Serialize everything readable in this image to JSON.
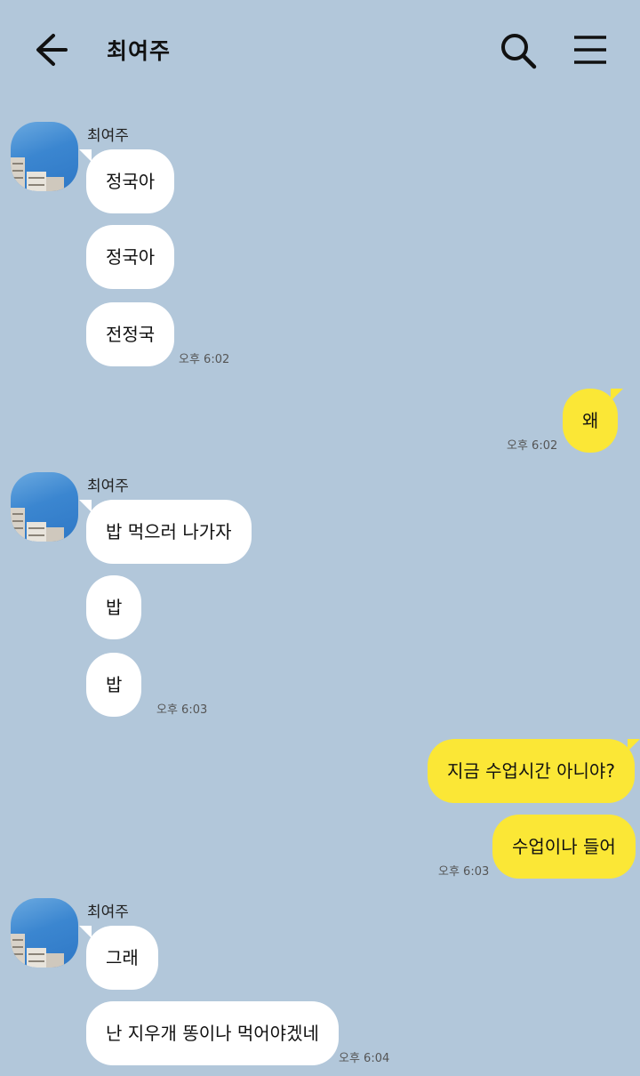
{
  "header": {
    "title": "최여주",
    "back_icon": "arrow-left-icon",
    "search_icon": "search-icon",
    "menu_icon": "hamburger-menu-icon"
  },
  "colors": {
    "background": "#b2c7da",
    "incoming_bubble": "#ffffff",
    "outgoing_bubble": "#fbe736"
  },
  "messages": {
    "group1": {
      "sender": "최여주",
      "m1": "정국아",
      "m2": "정국아",
      "m3": "전정국",
      "time": "오후 6:02"
    },
    "out1": {
      "m1": "왜",
      "time": "오후 6:02"
    },
    "group2": {
      "sender": "최여주",
      "m1": "밥 먹으러 나가자",
      "m2": "밥",
      "m3": "밥",
      "time": "오후 6:03"
    },
    "out2": {
      "m1": "지금 수업시간 아니야?",
      "m2": "수업이나 들어",
      "time": "오후 6:03"
    },
    "group3": {
      "sender": "최여주",
      "m1": "그래",
      "m2": "난 지우개 똥이나 먹어야겠네",
      "time": "오후 6:04"
    }
  }
}
